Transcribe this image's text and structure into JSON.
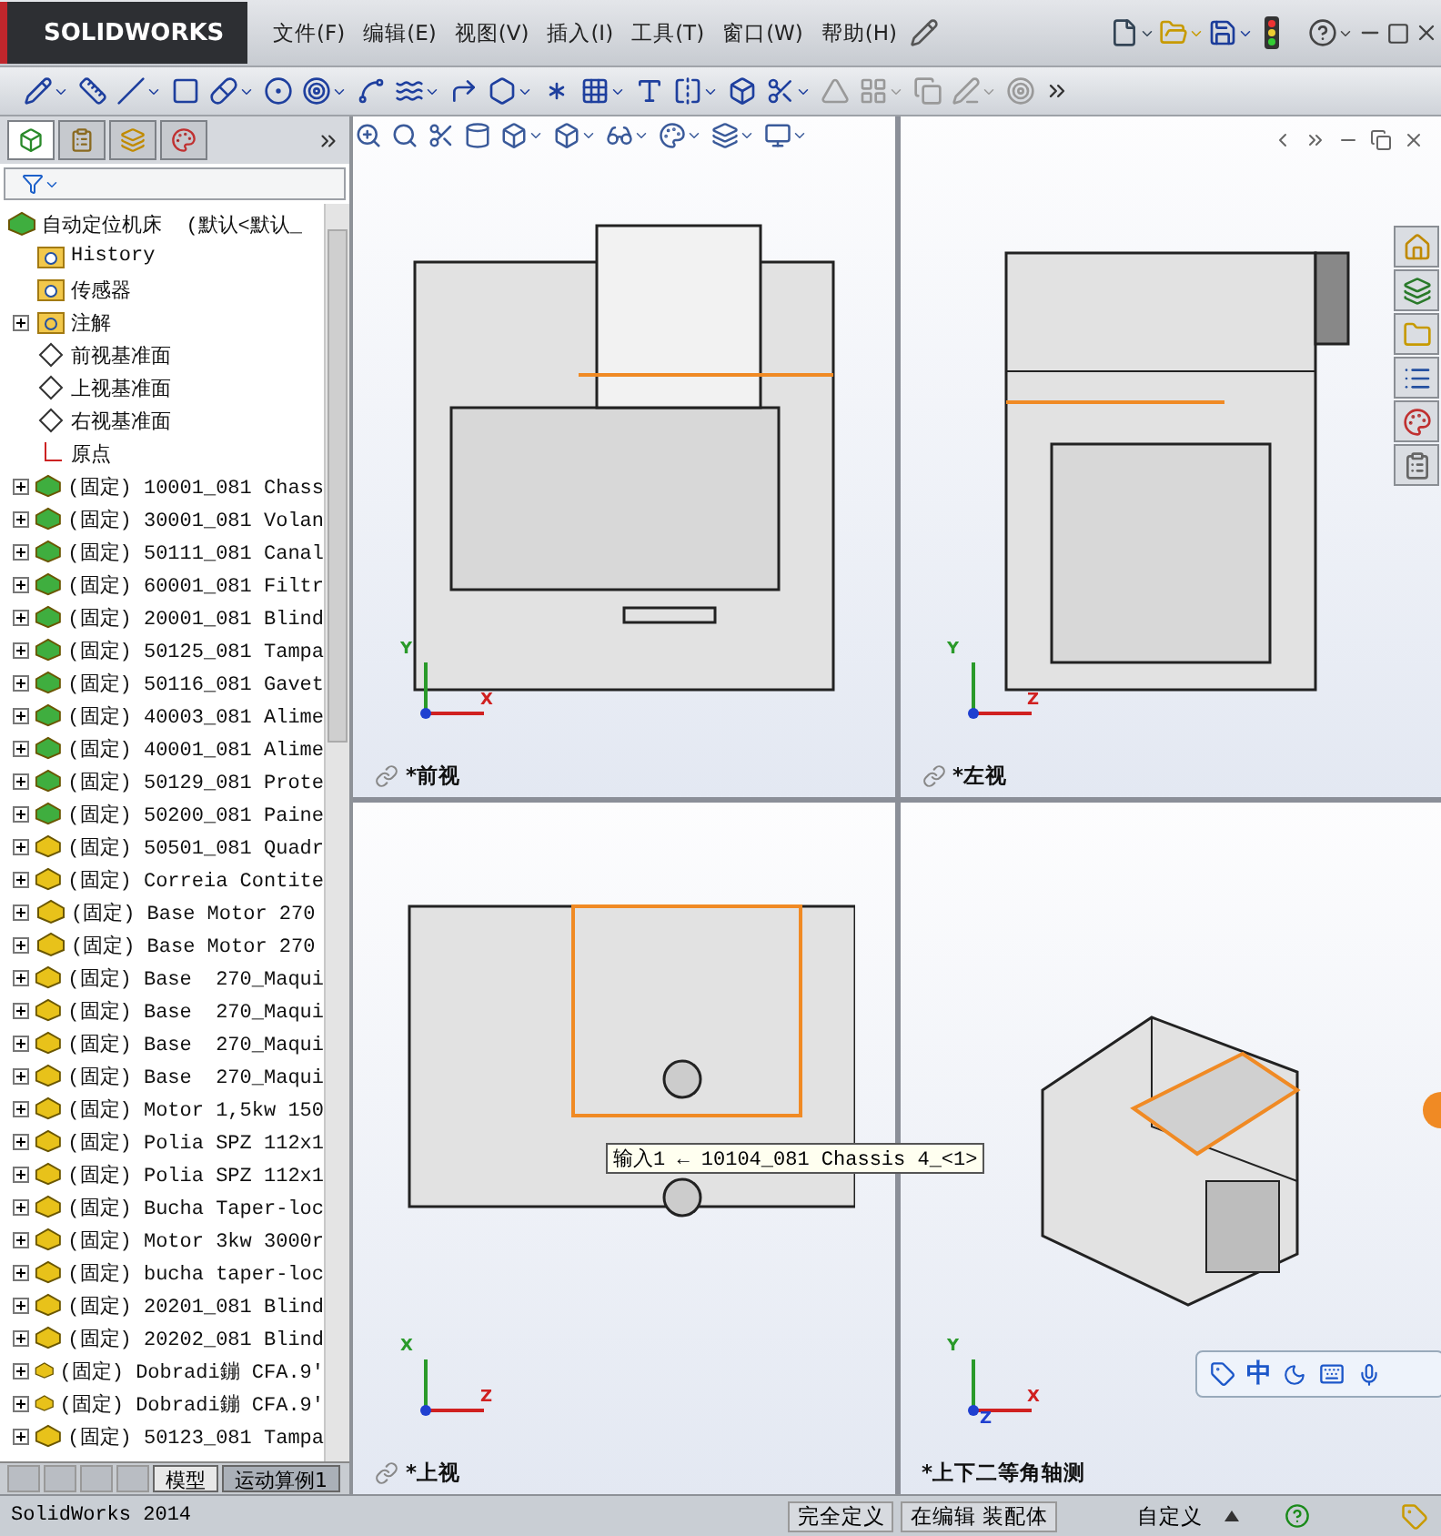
{
  "app": {
    "logo": "SOLIDWORKS"
  },
  "menu": [
    {
      "label": "文件(F)"
    },
    {
      "label": "编辑(E)"
    },
    {
      "label": "视图(V)"
    },
    {
      "label": "插入(I)"
    },
    {
      "label": "工具(T)"
    },
    {
      "label": "窗口(W)"
    },
    {
      "label": "帮助(H)"
    }
  ],
  "panel_tabs": [
    {
      "kind": "tree",
      "selected": true
    },
    {
      "kind": "property",
      "selected": false
    },
    {
      "kind": "config",
      "selected": false
    },
    {
      "kind": "display",
      "selected": false
    }
  ],
  "feature_tree": {
    "root": {
      "label": "自动定位机床  (默认<默认_",
      "children": [
        {
          "kind": "history",
          "label": "History",
          "expandable": false
        },
        {
          "kind": "sensor",
          "label": "传感器",
          "expandable": false
        },
        {
          "kind": "annotation",
          "label": "注解",
          "expandable": true
        },
        {
          "kind": "plane",
          "label": "前视基准面",
          "expandable": false
        },
        {
          "kind": "plane",
          "label": "上视基准面",
          "expandable": false
        },
        {
          "kind": "plane",
          "label": "右视基准面",
          "expandable": false
        },
        {
          "kind": "origin",
          "label": "原点",
          "expandable": false
        },
        {
          "kind": "assembly",
          "label": "(固定) 10001_081 Chass",
          "expandable": true
        },
        {
          "kind": "assembly",
          "label": "(固定) 30001_081 Volan",
          "expandable": true
        },
        {
          "kind": "assembly",
          "label": "(固定) 50111_081 Canal",
          "expandable": true
        },
        {
          "kind": "assembly",
          "label": "(固定) 60001_081 Filtr",
          "expandable": true
        },
        {
          "kind": "assembly",
          "label": "(固定) 20001_081 Blind",
          "expandable": true
        },
        {
          "kind": "assembly",
          "label": "(固定) 50125_081 Tampa",
          "expandable": true
        },
        {
          "kind": "assembly",
          "label": "(固定) 50116_081 Gavet",
          "expandable": true
        },
        {
          "kind": "assembly",
          "label": "(固定) 40003_081 Alime",
          "expandable": true
        },
        {
          "kind": "assembly",
          "label": "(固定) 40001_081 Alime",
          "expandable": true
        },
        {
          "kind": "assembly",
          "label": "(固定) 50129_081 Prote",
          "expandable": true
        },
        {
          "kind": "assembly",
          "label": "(固定) 50200_081 Paine",
          "expandable": true
        },
        {
          "kind": "part",
          "label": "(固定) 50501_081 Quadr",
          "expandable": true
        },
        {
          "kind": "part",
          "label": "(固定) Correia Contite",
          "expandable": true
        },
        {
          "kind": "part",
          "label": "(固定) Base Motor 270",
          "expandable": true
        },
        {
          "kind": "part",
          "label": "(固定) Base Motor 270",
          "expandable": true
        },
        {
          "kind": "part",
          "label": "(固定) Base  270_Maqui",
          "expandable": true
        },
        {
          "kind": "part",
          "label": "(固定) Base  270_Maqui",
          "expandable": true
        },
        {
          "kind": "part",
          "label": "(固定) Base  270_Maqui",
          "expandable": true
        },
        {
          "kind": "part",
          "label": "(固定) Base  270_Maqui",
          "expandable": true
        },
        {
          "kind": "part",
          "label": "(固定) Motor 1,5kw 150",
          "expandable": true
        },
        {
          "kind": "part",
          "label": "(固定) Polia SPZ 112x1",
          "expandable": true
        },
        {
          "kind": "part",
          "label": "(固定) Polia SPZ 112x1",
          "expandable": true
        },
        {
          "kind": "part",
          "label": "(固定) Bucha Taper-loc",
          "expandable": true
        },
        {
          "kind": "part",
          "label": "(固定) Motor 3kw 3000r",
          "expandable": true
        },
        {
          "kind": "part",
          "label": "(固定) bucha taper-loc",
          "expandable": true
        },
        {
          "kind": "part",
          "label": "(固定) 20201_081 Blind",
          "expandable": true
        },
        {
          "kind": "part",
          "label": "(固定) 20202_081 Blind",
          "expandable": true
        },
        {
          "kind": "part",
          "label": "(固定) Dobradi鏰 CFA.9'",
          "expandable": true
        },
        {
          "kind": "part",
          "label": "(固定) Dobradi鏰 CFA.9'",
          "expandable": true
        },
        {
          "kind": "part",
          "label": "(固定) 50123_081 Tampa",
          "expandable": true
        }
      ]
    }
  },
  "bottom_tabs": [
    {
      "label": "模型",
      "selected": true
    },
    {
      "label": "运动算例1",
      "selected": false
    }
  ],
  "views": [
    {
      "kind": "front",
      "label": "*前视",
      "link_icon": true,
      "axes": [
        "Y",
        "X"
      ]
    },
    {
      "kind": "left",
      "label": "*左视",
      "link_icon": true,
      "axes": [
        "Y",
        "Z"
      ]
    },
    {
      "kind": "top",
      "label": "*上视",
      "link_icon": true,
      "axes": [
        "X",
        "Z"
      ]
    },
    {
      "kind": "iso",
      "label": "*上下二等角轴测",
      "link_icon": false,
      "axes": [
        "Y",
        "X",
        "Z"
      ]
    }
  ],
  "tooltip": "输入1 ← 10104_081 Chassis 4_<1>",
  "ime": {
    "mode": "中"
  },
  "status_bar": {
    "app": "SolidWorks 2014",
    "cells": [
      "完全定义",
      "在编辑 装配体",
      "自定义"
    ]
  }
}
